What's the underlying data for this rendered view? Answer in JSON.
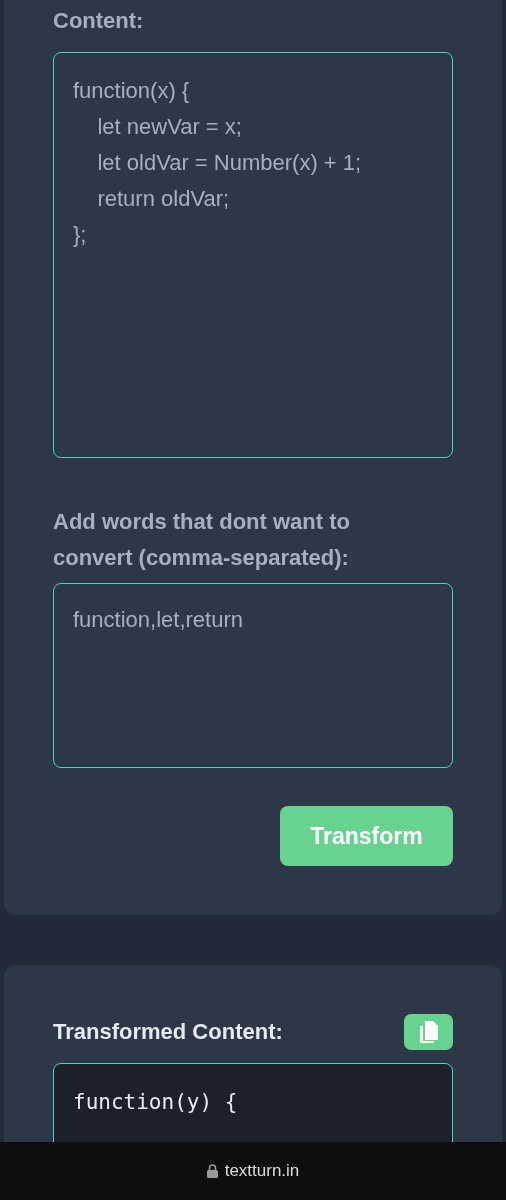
{
  "input_card": {
    "content_label": "Content:",
    "content_value": "function(x) {\n    let newVar = x;\n    let oldVar = Number(x) + 1;\n    return oldVar;\n};",
    "exclude_label": "Add words that dont want to convert (comma-separated):",
    "exclude_value": "function,let,return",
    "transform_button": "Transform"
  },
  "output_card": {
    "label": "Transformed Content:",
    "code_lines": [
      "function(y) {"
    ]
  },
  "browser_bar": {
    "url": "textturn.in"
  }
}
